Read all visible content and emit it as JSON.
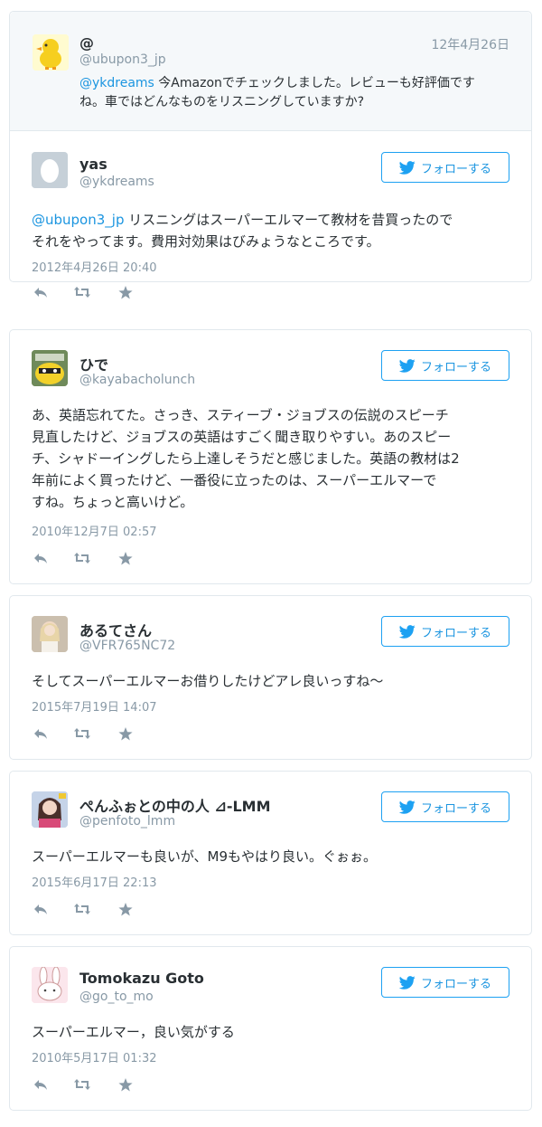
{
  "parent": {
    "name": "@",
    "handle": "@ubupon3_jp",
    "date": "12年4月26日",
    "mention": "@ykdreams",
    "text_line1": " 今Amazonでチェックしました。レビューも好評価です",
    "text_line2": "ね。車ではどんなものをリスニングしていますか?"
  },
  "follow_label": "フォローする",
  "colors": {
    "accent": "#1da1f2",
    "link": "#1b95e0",
    "muted": "#8899a6",
    "border": "#e1e8ed",
    "parent_bg": "#f5f8fa"
  },
  "icons": [
    "reply-icon",
    "retweet-icon",
    "favorite-icon",
    "twitter-bird-icon"
  ],
  "tweets": [
    {
      "name": "yas",
      "handle": "@ykdreams",
      "mention": "@ubupon3_jp",
      "lines": [
        " リスニングはスーパーエルマーて教材を昔買ったので",
        "それをやってます。費用対効果はびみょうなところです。"
      ],
      "timestamp": "2012年4月26日 20:40"
    },
    {
      "name": "ひで",
      "handle": "@kayabacholunch",
      "lines": [
        "あ、英語忘れてた。さっき、スティーブ・ジョブスの伝説のスピーチ",
        "見直したけど、ジョブスの英語はすごく聞き取りやすい。あのスピー",
        "チ、シャドーイングしたら上達しそうだと感じました。英語の教材は2",
        "年前によく買ったけど、一番役に立ったのは、スーパーエルマーで",
        "すね。ちょっと高いけど。"
      ],
      "timestamp": "2010年12月7日 02:57"
    },
    {
      "name": "あるてさん",
      "handle": "@VFR765NC72",
      "lines": [
        "そしてスーパーエルマーお借りしたけどアレ良いっすね〜"
      ],
      "timestamp": "2015年7月19日 14:07"
    },
    {
      "name": "ぺんふぉとの中の人 ⊿-LMM",
      "handle": "@penfoto_lmm",
      "lines": [
        "スーパーエルマーも良いが、M9もやはり良い。ぐぉぉ。"
      ],
      "timestamp": "2015年6月17日 22:13"
    },
    {
      "name": "Tomokazu Goto",
      "handle": "@go_to_mo",
      "lines": [
        "スーパーエルマー，良い気がする"
      ],
      "timestamp": "2010年5月17日 01:32"
    }
  ]
}
